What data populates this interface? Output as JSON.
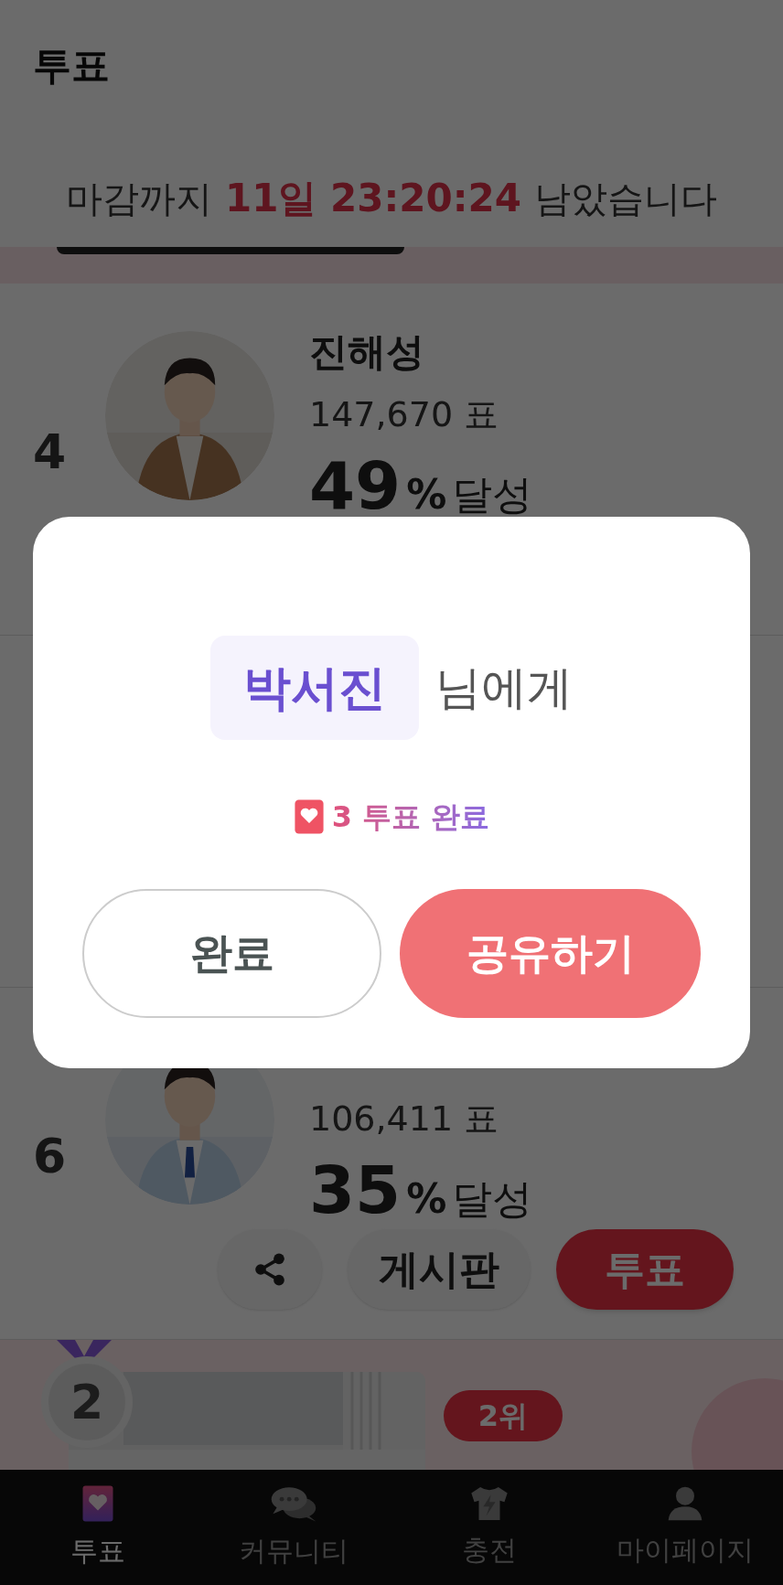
{
  "header": {
    "title": "투표",
    "countdown": {
      "prefix": "마감까지",
      "remaining": "11일 23:20:24",
      "suffix": "남았습니다"
    }
  },
  "candidates": [
    {
      "rank": "4",
      "name": "진해성",
      "votes": "147,670 표",
      "percent": "49",
      "percent_sign": "%",
      "achieved": "달성"
    },
    {
      "rank": "6",
      "votes": "106,411 표",
      "percent": "35",
      "percent_sign": "%",
      "achieved": "달성",
      "actions": [
        {
          "kind": "share"
        },
        {
          "kind": "board",
          "label": "게시판"
        },
        {
          "kind": "vote",
          "label": "투표"
        }
      ]
    }
  ],
  "ranking_banner": {
    "medal": "2",
    "badge": "2위"
  },
  "nav": [
    {
      "label": "투표",
      "selected": true
    },
    {
      "label": "커뮤니티",
      "selected": false
    },
    {
      "label": "충전",
      "selected": false
    },
    {
      "label": "마이페이지",
      "selected": false
    }
  ],
  "dialog": {
    "recipient": "박서진",
    "recipient_suffix": "님에게",
    "result": "3 투표 완료",
    "buttons": [
      {
        "kind": "secondary",
        "label": "완료"
      },
      {
        "kind": "primary",
        "label": "공유하기"
      }
    ]
  }
}
